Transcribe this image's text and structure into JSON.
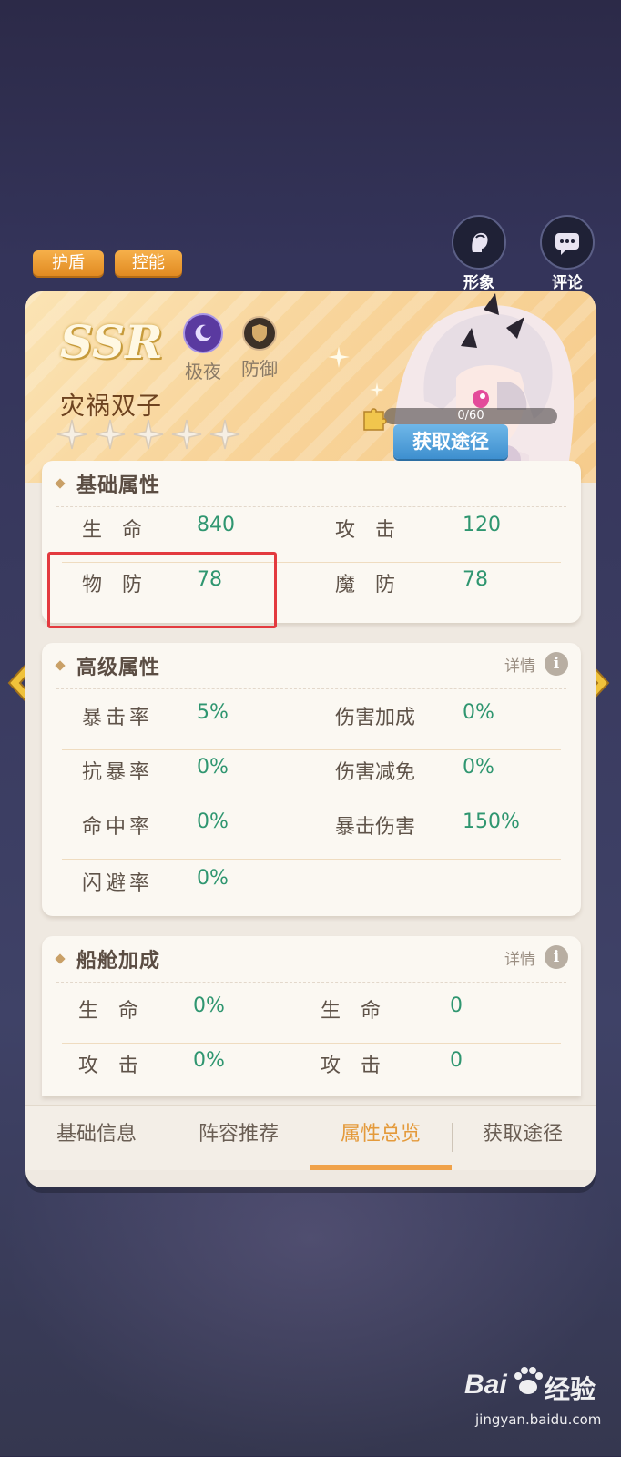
{
  "tags": [
    "护盾",
    "控能"
  ],
  "top_buttons": {
    "appearance": "形象",
    "comment": "评论"
  },
  "hero": {
    "rarity": "SSR",
    "faction": "极夜",
    "role": "防御",
    "name": "灾祸双子",
    "stars_total": 5,
    "stars_filled": 0,
    "fragments": "0/60",
    "get_path_button": "获取途径"
  },
  "basic": {
    "title": "基础属性",
    "rows": [
      {
        "l_label": "生　命",
        "l_value": "840",
        "r_label": "攻　击",
        "r_value": "120"
      },
      {
        "l_label": "物　防",
        "l_value": "78",
        "r_label": "魔　防",
        "r_value": "78"
      }
    ]
  },
  "advanced": {
    "title": "高级属性",
    "detail": "详情",
    "rows": [
      {
        "l_label": "暴击率",
        "l_value": "5%",
        "r_label": "伤害加成",
        "r_value": "0%"
      },
      {
        "l_label": "抗暴率",
        "l_value": "0%",
        "r_label": "伤害减免",
        "r_value": "0%"
      },
      {
        "l_label": "命中率",
        "l_value": "0%",
        "r_label": "暴击伤害",
        "r_value": "150%"
      },
      {
        "l_label": "闪避率",
        "l_value": "0%",
        "r_label": "",
        "r_value": ""
      }
    ]
  },
  "ship": {
    "title": "船舱加成",
    "detail": "详情",
    "rows": [
      {
        "l_label": "生　命",
        "l_value": "0%",
        "r_label": "生　命",
        "r_value": "0"
      },
      {
        "l_label": "攻　击",
        "l_value": "0%",
        "r_label": "攻　击",
        "r_value": "0"
      }
    ]
  },
  "tabs": [
    "基础信息",
    "阵容推荐",
    "属性总览",
    "获取途径"
  ],
  "active_tab": "属性总览",
  "watermark": {
    "brand": "Bai",
    "cn": "经验",
    "url": "jingyan.baidu.com"
  },
  "colors": {
    "value_green": "#2f9670",
    "accent_orange": "#f0a24a",
    "highlight_red": "#e33a3f"
  }
}
